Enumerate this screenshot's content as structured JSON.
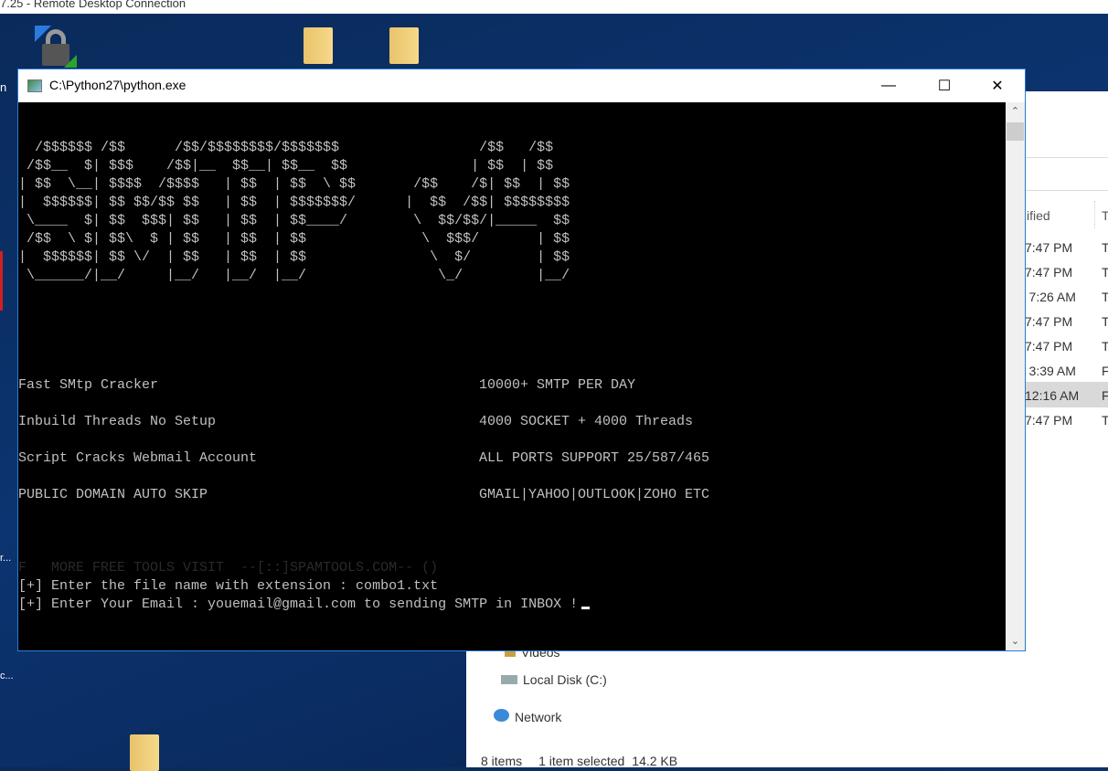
{
  "rdp": {
    "title": "7.25 - Remote Desktop Connection"
  },
  "desktop": {
    "left_labels": [
      "n",
      "r...",
      "c..."
    ]
  },
  "window": {
    "title": "C:\\Python27\\python.exe",
    "minimize": "—",
    "maximize": "☐",
    "close": "✕"
  },
  "console": {
    "ascii_art": "  /$$$$$$ /$$      /$$/$$$$$$$$/$$$$$$$                 /$$   /$$\n /$$__  $| $$$    /$$|__  $$__| $$__  $$               | $$  | $$\n| $$  \\__| $$$$  /$$$$   | $$  | $$  \\ $$       /$$    /$| $$  | $$\n|  $$$$$$| $$ $$/$$ $$   | $$  | $$$$$$$/      |  $$  /$$| $$$$$$$$\n \\____  $| $$  $$$| $$   | $$  | $$____/        \\  $$/$$/|_____  $$\n /$$  \\ $| $$\\  $ | $$   | $$  | $$              \\  $$$/       | $$\n|  $$$$$$| $$ \\/  | $$   | $$  | $$               \\  $/        | $$\n \\______/|__/     |__/   |__/  |__/                \\_/         |__/",
    "features": [
      {
        "left": "Fast SMtp Cracker",
        "right": "10000+ SMTP PER DAY"
      },
      {
        "left": "Inbuild Threads No Setup",
        "right": "4000 SOCKET + 4000 Threads"
      },
      {
        "left": "Script Cracks Webmail Account",
        "right": "ALL PORTS SUPPORT 25/587/465"
      },
      {
        "left": "PUBLIC DOMAIN AUTO SKIP",
        "right": "GMAIL|YAHOO|OUTLOOK|ZOHO ETC"
      }
    ],
    "faded_line": "F   MORE FREE TOOLS VISIT  --[::]SPAMTOOLS.COM-- ()",
    "prompt1": "[+] Enter the file name with extension : combo1.txt",
    "prompt2": "[+] Enter Your Email : youemail@gmail.com to sending SMTP in INBOX !"
  },
  "explorer": {
    "column_header": "ified",
    "column_header2": "T",
    "rows": [
      {
        "time": "7:47 PM",
        "type": "T"
      },
      {
        "time": "7:47 PM",
        "type": "T"
      },
      {
        "time": ") 7:26 AM",
        "type": "T"
      },
      {
        "time": "7:47 PM",
        "type": "T"
      },
      {
        "time": "7:47 PM",
        "type": "T"
      },
      {
        "time": ") 3:39 AM",
        "type": "F"
      },
      {
        "time": "12:16 AM",
        "type": "F"
      },
      {
        "time": "7:47 PM",
        "type": "T"
      }
    ],
    "nav": [
      "Videos",
      "Local Disk (C:)",
      "Network"
    ],
    "status": {
      "items": "8 items",
      "selected": "1 item selected",
      "size": "14.2 KB"
    }
  }
}
